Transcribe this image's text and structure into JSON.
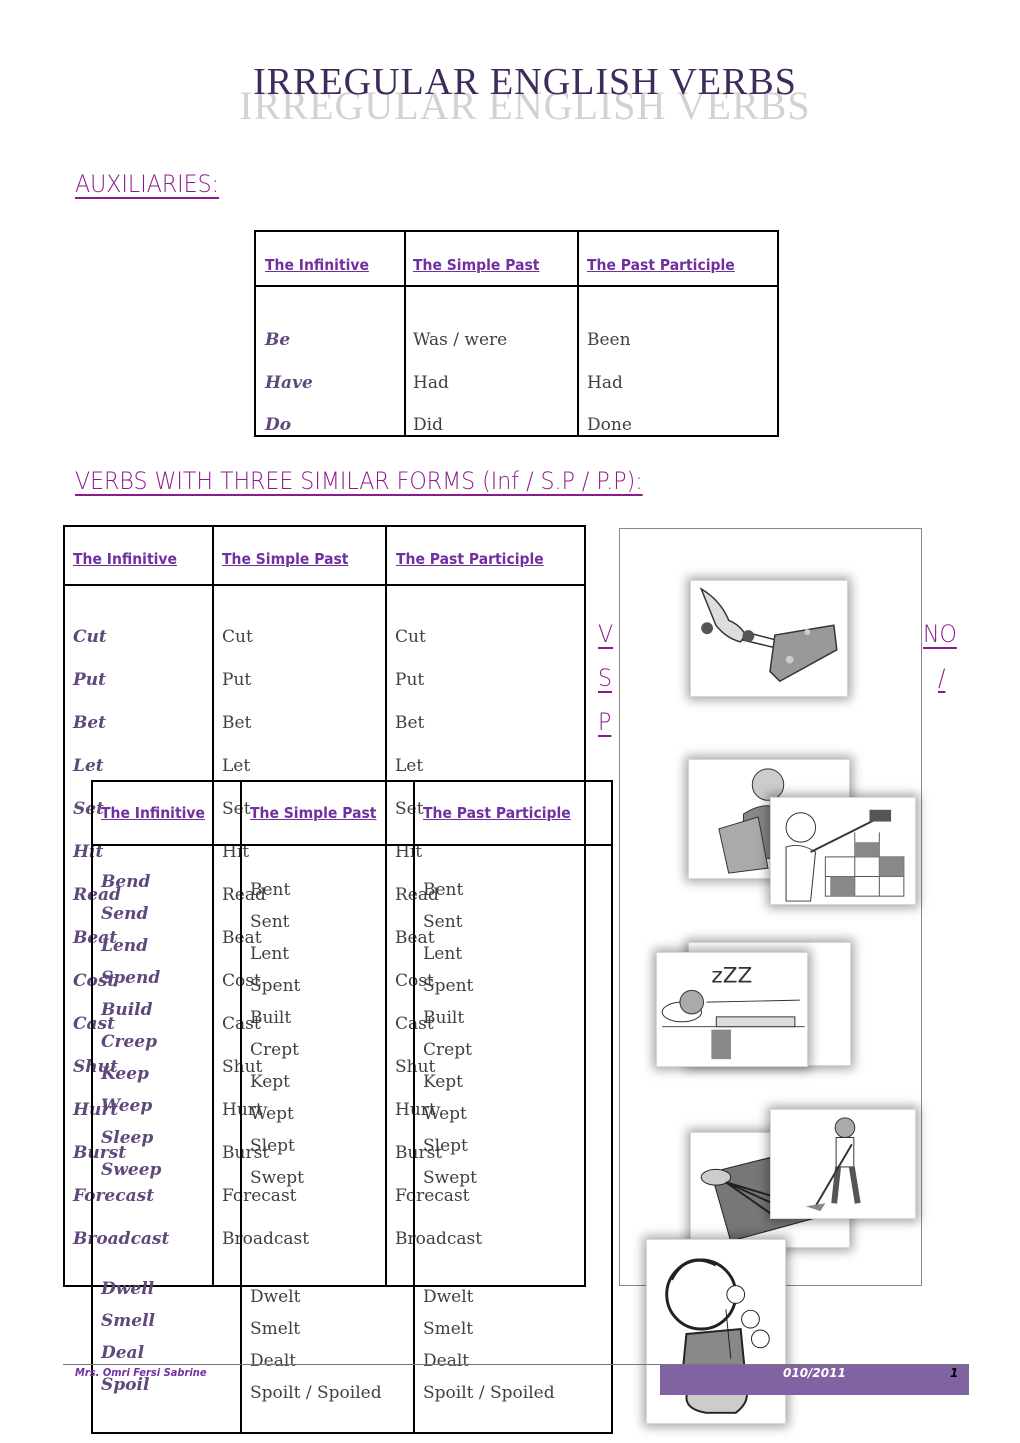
{
  "title": "IRREGULAR ENGLISH VERBS",
  "sections": {
    "auxiliaries": {
      "heading": "AUXILIARIES:",
      "headers": [
        "The Infinitive",
        "The Simple Past",
        "The Past Participle"
      ],
      "rows": [
        [
          "Be",
          "Was / were",
          "Been"
        ],
        [
          "Have",
          "Had",
          "Had"
        ],
        [
          "Do",
          "Did",
          "Done"
        ]
      ]
    },
    "three_similar": {
      "heading": "VERBS WITH THREE SIMILAR FORMS (Inf / S.P / P.P):",
      "headers": [
        "The Infinitive",
        "The Simple Past",
        "The Past Participle"
      ],
      "rows": [
        [
          "Cut",
          "Cut",
          "Cut"
        ],
        [
          "Put",
          "Put",
          "Put"
        ],
        [
          "Bet",
          "Bet",
          "Bet"
        ],
        [
          "Let",
          "Let",
          "Let"
        ],
        [
          "Set",
          "Set",
          "Set"
        ],
        [
          "Hit",
          "Hit",
          "Hit"
        ],
        [
          "Read",
          "Read",
          "Read"
        ],
        [
          "Beat",
          "Beat",
          "Beat"
        ],
        [
          "Cost",
          "Cost",
          "Cost"
        ],
        [
          "Cast",
          "Cast",
          "Cast"
        ],
        [
          "Shut",
          "Shut",
          "Shut"
        ],
        [
          "Hurt",
          "Hurt",
          "Hurt"
        ],
        [
          "Burst",
          "Burst",
          "Burst"
        ],
        [
          "Forecast",
          "Forecast",
          "Forecast"
        ],
        [
          "Broadcast",
          "Broadcast",
          "Broadcast"
        ]
      ]
    },
    "two_similar": {
      "heading_fragments": [
        "V",
        "NO",
        "S",
        "/",
        "P"
      ],
      "headers": [
        "The Infinitive",
        "The Simple Past",
        "The Past Participle"
      ],
      "rows": [
        [
          "Bend",
          "Bent",
          "Bent"
        ],
        [
          "Send",
          "Sent",
          "Sent"
        ],
        [
          "Lend",
          "Lent",
          "Lent"
        ],
        [
          "Spend",
          "Spent",
          "Spent"
        ],
        [
          "Build",
          "Built",
          "Built"
        ],
        [
          "Creep",
          "Crept",
          "Crept"
        ],
        [
          "Keep",
          "Kept",
          "Kept"
        ],
        [
          "Weep",
          "Wept",
          "Wept"
        ],
        [
          "Sleep",
          "Slept",
          "Slept"
        ],
        [
          "Sweep",
          "Swept",
          "Swept"
        ],
        [
          "Dwell",
          "Dwelt",
          "Dwelt"
        ],
        [
          "Smell",
          "Smelt",
          "Smelt"
        ],
        [
          "Deal",
          "Dealt",
          "Dealt"
        ],
        [
          "Spoil",
          "Spoilt / Spoiled",
          "Spoilt / Spoiled"
        ]
      ]
    }
  },
  "illustrations": [
    "cutting-cheese",
    "reading-book",
    "building-wall",
    "sleeping",
    "whisking",
    "sweeping",
    "smelling-flowers"
  ],
  "footer": {
    "author": "Mrs. Omri Fersi Sabrine",
    "year": "010/2011",
    "page": "1"
  },
  "colors": {
    "heading": "#8b1a8b",
    "header_link": "#7030a0",
    "infinitive": "#5f497a",
    "footer_bar": "#8064a2",
    "title": "#3f2a5c"
  }
}
